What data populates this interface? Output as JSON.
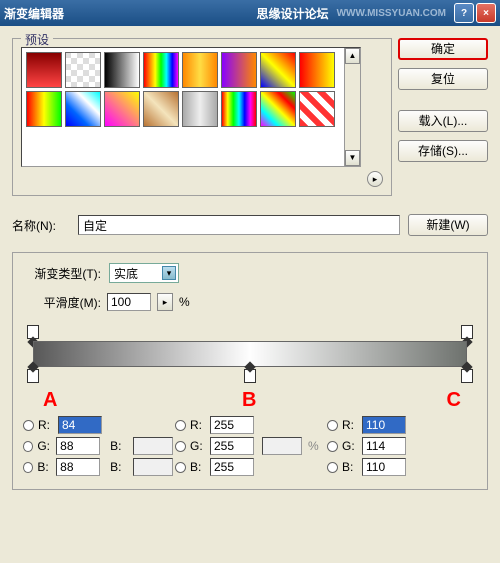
{
  "title": "渐变编辑器",
  "watermark_text": "思缘设计论坛",
  "watermark_url": "WWW.MISSYUAN.COM",
  "preset_legend": "预设",
  "buttons": {
    "ok": "确定",
    "reset": "复位",
    "load": "载入(L)...",
    "save": "存储(S)...",
    "new": "新建(W)"
  },
  "name_label": "名称(N):",
  "name_value": "自定",
  "type_label": "渐变类型(T):",
  "type_value": "实底",
  "smooth_label": "平滑度(M):",
  "smooth_value": "100",
  "smooth_unit": "%",
  "labels": {
    "r": "R:",
    "g": "G:",
    "b": "B:"
  },
  "letters": {
    "a": "A",
    "b": "B",
    "c": "C"
  },
  "rgb": {
    "a": {
      "r": "84",
      "g": "88",
      "b": "88"
    },
    "b": {
      "r": "255",
      "g": "255",
      "b": "255"
    },
    "c": {
      "r": "110",
      "g": "114",
      "b": "110"
    }
  },
  "pct": "%",
  "swatches": [
    "linear-gradient(to bottom,#800,#f44)",
    "repeating-conic-gradient(#fff 0 25%,#ddd 0 50%) 50%/12px 12px",
    "linear-gradient(to right,#000,#fff)",
    "linear-gradient(to right,#f00 0%,#ff0 33%,#0f0 50%,#0ff 66%,#00f 83%,#f0f 100%)",
    "linear-gradient(to right,#f80,#fd4,#f80)",
    "linear-gradient(to right,#80f,#f80)",
    "linear-gradient(45deg,#00f,#ff0,#f00)",
    "linear-gradient(to right,#f00,#ff0)",
    "linear-gradient(to right,#f00,#ff0,#0f0)",
    "linear-gradient(45deg,#00f,#06f,#fff,#0ff)",
    "linear-gradient(45deg,#f0f,#ff0)",
    "linear-gradient(45deg,#b87333,#f4e4bc,#b87333)",
    "linear-gradient(to right,#aaa,#eee,#aaa)",
    "linear-gradient(to right,#f00,#ff0,#0f0,#0ff,#00f,#f0f,#f00)",
    "linear-gradient(45deg,#f0f 0%,#0ff 25%,#ff0 50%,#f00 75%,#0f0 100%)",
    "repeating-linear-gradient(45deg,#f33 0 6px,#fff 6px 12px)"
  ]
}
